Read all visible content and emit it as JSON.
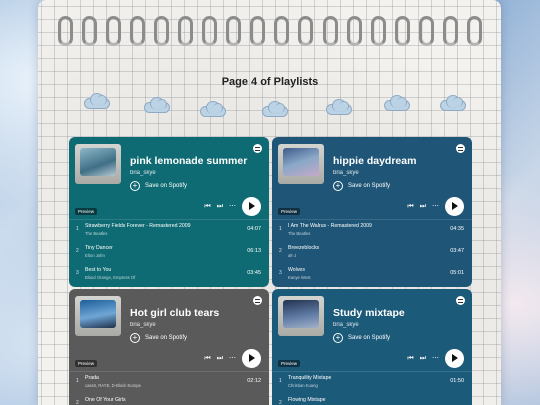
{
  "page": {
    "title": "Page 4 of Playlists"
  },
  "colors": {
    "card1": "#0f6b73",
    "card2": "#1f5677",
    "card3": "#5a5a5a",
    "card4": "#1c5a7a"
  },
  "cards": [
    {
      "title": "pink lemonade summer",
      "user": "bria_skye",
      "save_label": "Save on Spotify",
      "preview": "Preview",
      "tracks": [
        {
          "num": "1",
          "name": "Strawberry Fields Forever - Remastered 2009",
          "artist": "The Beatles",
          "dur": "04:07"
        },
        {
          "num": "2",
          "name": "Tiny Dancer",
          "artist": "Elton John",
          "dur": "06:13"
        },
        {
          "num": "3",
          "name": "Best to You",
          "artist": "Blood Orange, Empress Of",
          "dur": "03:45"
        }
      ]
    },
    {
      "title": "hippie daydream",
      "user": "bria_skye",
      "save_label": "Save on Spotify",
      "preview": "Preview",
      "tracks": [
        {
          "num": "1",
          "name": "I Am The Walrus - Remastered 2009",
          "artist": "The Beatles",
          "dur": "04:35"
        },
        {
          "num": "2",
          "name": "Breezeblocks",
          "artist": "alt-J",
          "dur": "03:47"
        },
        {
          "num": "3",
          "name": "Wolves",
          "artist": "Kanye West",
          "dur": "05:01"
        }
      ]
    },
    {
      "title": "Hot girl club tears",
      "user": "bria_skye",
      "save_label": "Save on Spotify",
      "preview": "Preview",
      "tracks": [
        {
          "num": "1",
          "name": "Prada",
          "artist": "cassö, RAYE, D-Block Europe",
          "dur": "02:12"
        },
        {
          "num": "2",
          "name": "One Of Your Girls",
          "artist": "",
          "dur": ""
        }
      ]
    },
    {
      "title": "Study mixtape",
      "user": "bria_skye",
      "save_label": "Save on Spotify",
      "preview": "Preview",
      "tracks": [
        {
          "num": "1",
          "name": "Tranquility Mixtape",
          "artist": "Christian Kuang",
          "dur": "01:50"
        },
        {
          "num": "2",
          "name": "Flowing Mixtape",
          "artist": "",
          "dur": ""
        }
      ]
    }
  ]
}
